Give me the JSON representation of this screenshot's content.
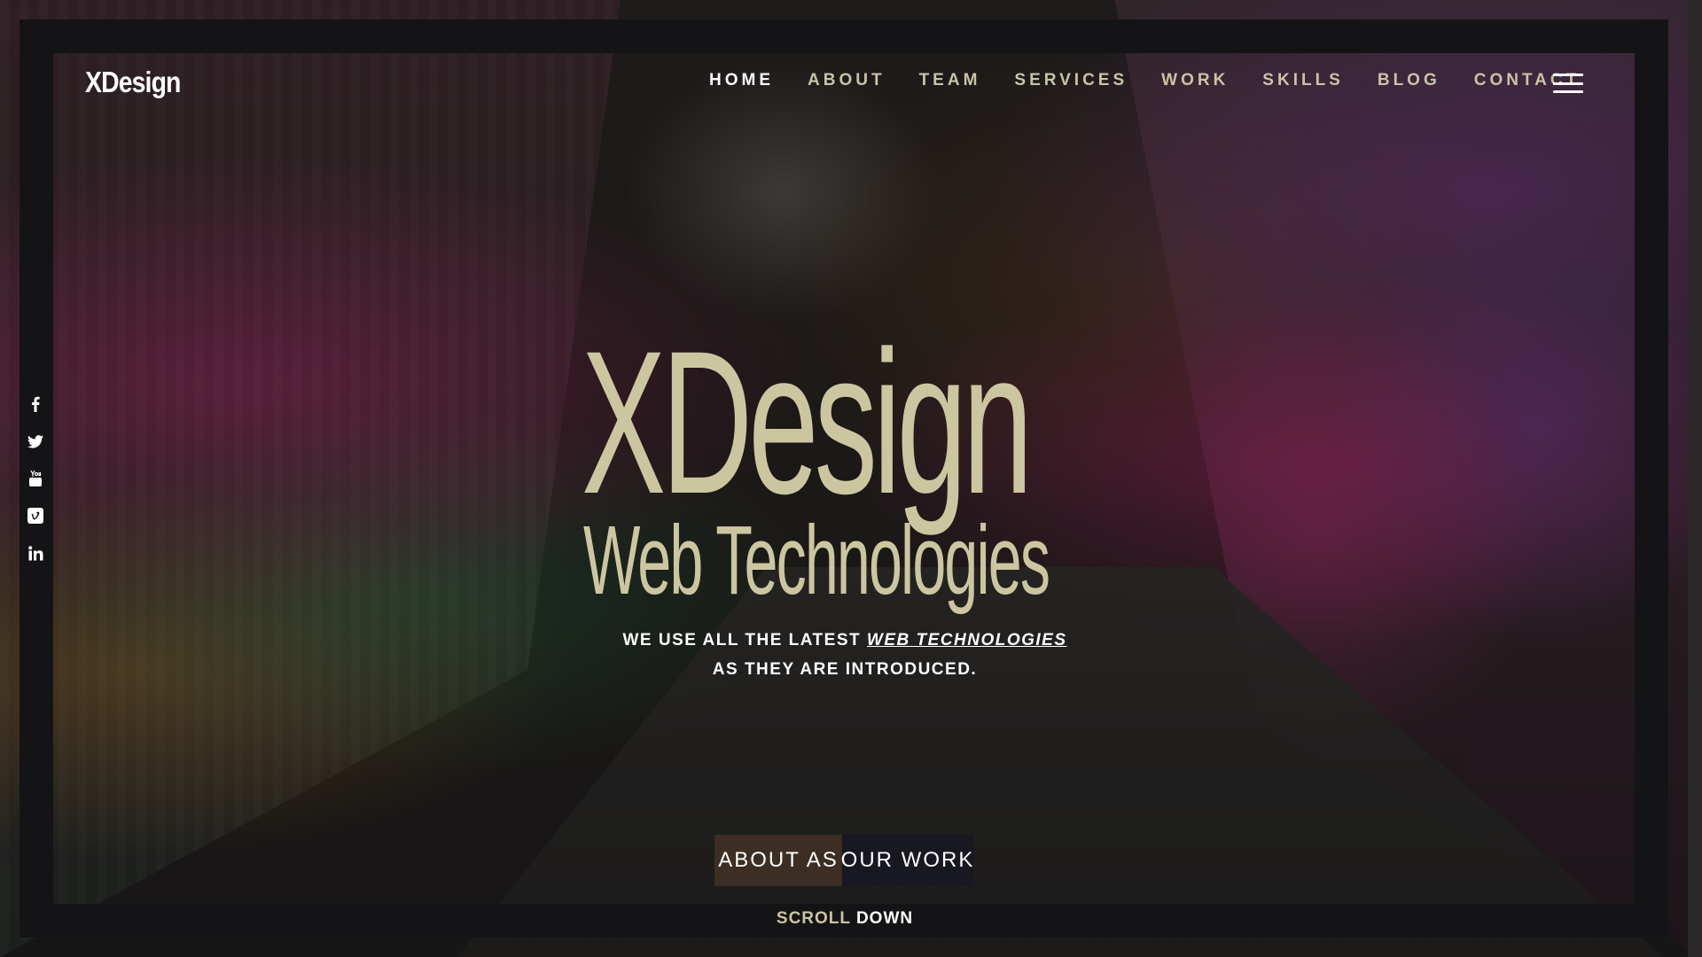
{
  "brand": {
    "logo": "XDesign"
  },
  "nav": {
    "items": [
      {
        "label": "HOME",
        "active": true
      },
      {
        "label": "ABOUT",
        "active": false
      },
      {
        "label": "TEAM",
        "active": false
      },
      {
        "label": "SERVICES",
        "active": false
      },
      {
        "label": "WORK",
        "active": false
      },
      {
        "label": "SKILLS",
        "active": false
      },
      {
        "label": "BLOG",
        "active": false
      },
      {
        "label": "CONTACT",
        "active": false
      }
    ],
    "menu_icon": "hamburger-menu-icon"
  },
  "social": [
    {
      "icon": "facebook-icon"
    },
    {
      "icon": "twitter-icon"
    },
    {
      "icon": "youtube-icon"
    },
    {
      "icon": "vimeo-icon"
    },
    {
      "icon": "linkedin-icon"
    }
  ],
  "hero": {
    "title": "XDesign",
    "subtitle": "Web Technologies",
    "line1_before": "WE USE ALL THE LATEST ",
    "line1_emphasis": "WEB TECHNOLOGIES",
    "line2": "AS THEY ARE INTRODUCED."
  },
  "buttons": {
    "about": "ABOUT AS",
    "work": "OUR WORK"
  },
  "scroll": {
    "word1": "SCROLL",
    "word2": "DOWN"
  },
  "colors": {
    "accent": "#ccc6a0",
    "frame": "#141416",
    "about_button": "#3c2e22",
    "work_button": "#171821",
    "nav_text": "#c8c4a6",
    "nav_active": "#ffffff"
  }
}
